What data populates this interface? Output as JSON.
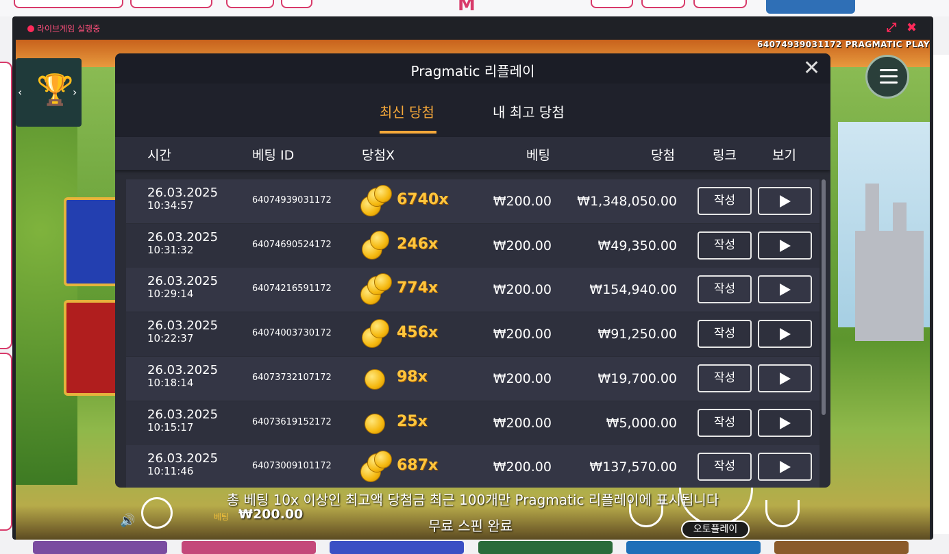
{
  "frame": {
    "live_status": "라이브게임 실행중"
  },
  "game": {
    "game_id_label": "64074939031172 PRAGMATIC PLAY",
    "bet_label": "베팅",
    "bet_value": "₩200.00",
    "status_text": "무료 스핀 완료",
    "autoplay_label": "오토플레이"
  },
  "modal": {
    "title": "Pragmatic 리플레이",
    "tabs": [
      {
        "label": "최신 당첨",
        "active": true
      },
      {
        "label": "내 최고 당첨",
        "active": false
      }
    ],
    "columns": [
      "시간",
      "베팅 ID",
      "당첨X",
      "베팅",
      "당첨",
      "링크",
      "보기"
    ],
    "rows": [
      {
        "date": "26.03.2025",
        "time": "10:34:57",
        "bet_id": "64074939031172",
        "multiplier": "6740x",
        "coins": 3,
        "bet": "₩200.00",
        "win": "₩1,348,050.00",
        "link_label": "작성"
      },
      {
        "date": "26.03.2025",
        "time": "10:31:32",
        "bet_id": "64074690524172",
        "multiplier": "246x",
        "coins": 2,
        "bet": "₩200.00",
        "win": "₩49,350.00",
        "link_label": "작성"
      },
      {
        "date": "26.03.2025",
        "time": "10:29:14",
        "bet_id": "64074216591172",
        "multiplier": "774x",
        "coins": 3,
        "bet": "₩200.00",
        "win": "₩154,940.00",
        "link_label": "작성"
      },
      {
        "date": "26.03.2025",
        "time": "10:22:37",
        "bet_id": "64074003730172",
        "multiplier": "456x",
        "coins": 2,
        "bet": "₩200.00",
        "win": "₩91,250.00",
        "link_label": "작성"
      },
      {
        "date": "26.03.2025",
        "time": "10:18:14",
        "bet_id": "64073732107172",
        "multiplier": "98x",
        "coins": 1,
        "bet": "₩200.00",
        "win": "₩19,700.00",
        "link_label": "작성"
      },
      {
        "date": "26.03.2025",
        "time": "10:15:17",
        "bet_id": "64073619152172",
        "multiplier": "25x",
        "coins": 1,
        "bet": "₩200.00",
        "win": "₩5,000.00",
        "link_label": "작성"
      },
      {
        "date": "26.03.2025",
        "time": "10:11:46",
        "bet_id": "64073009101172",
        "multiplier": "687x",
        "coins": 3,
        "bet": "₩200.00",
        "win": "₩137,570.00",
        "link_label": "작성"
      }
    ],
    "notice": "총 베팅 10x 이상인 최고액 당첨금 최근 100개만 Pragmatic 리플레이에 표시됩니다"
  },
  "colors": {
    "accent": "#f5a83a",
    "brand": "#d83a6a",
    "multiplier": "#ffc53d",
    "modal_bg": "#2a2c36"
  }
}
